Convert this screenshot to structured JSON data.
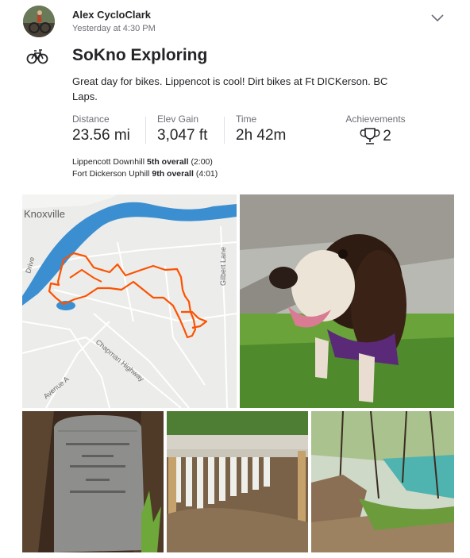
{
  "post": {
    "athlete_name": "Alex CycloClark",
    "timestamp": "Yesterday at 4:30 PM",
    "sport_icon": "bicycle-icon",
    "menu_icon": "chevron-down-icon"
  },
  "activity": {
    "title": "SoKno Exploring",
    "description": "Great day for bikes. Lippencot is cool! Dirt bikes at Ft DICKerson. BC Laps.",
    "stats": [
      {
        "label": "Distance",
        "value": "23.56 mi"
      },
      {
        "label": "Elev Gain",
        "value": "3,047 ft"
      },
      {
        "label": "Time",
        "value": "2h 42m"
      }
    ],
    "achievements": {
      "label": "Achievements",
      "count": "2",
      "icon": "trophy-icon"
    }
  },
  "segments": [
    {
      "name": "Lippencott Downhill",
      "rank": "5th overall",
      "time": "(2:00)"
    },
    {
      "name": "Fort Dickerson Uphill",
      "rank": "9th overall",
      "time": "(4:01)"
    }
  ],
  "map": {
    "place_label": "Knoxville",
    "street_labels": [
      "Chapman Highway",
      "Gilbert Lane",
      "Avenue A",
      "Drive"
    ],
    "route_color": "#fc5200",
    "river_color": "#3b8fd1"
  },
  "colors": {
    "accent": "#fc5200",
    "text": "#242428",
    "muted": "#6d6d78"
  }
}
